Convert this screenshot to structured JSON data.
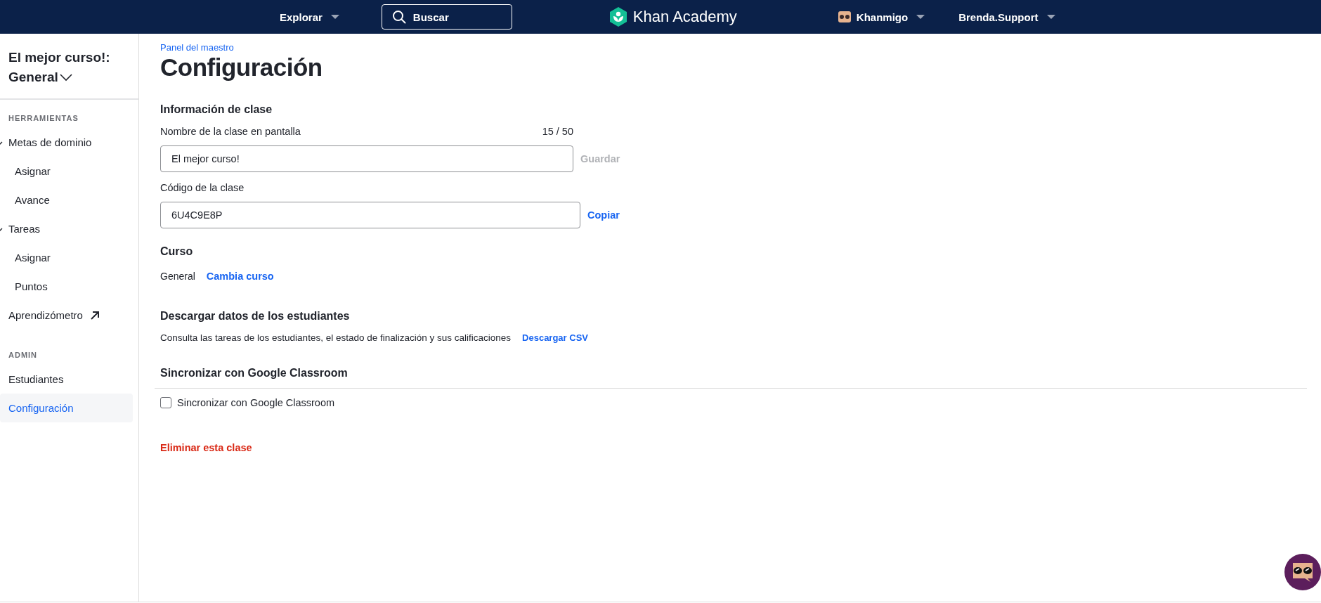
{
  "top_bar": {
    "explore": "Explorar",
    "search": {
      "placeholder": "Buscar"
    },
    "logo": "Khan Academy",
    "assistant": "Khanmigo",
    "user": "Brenda.Support"
  },
  "sidebar": {
    "class_title": "El mejor curso!:",
    "class_course": "General",
    "sections": [
      {
        "heading": "HERRAMIENTAS",
        "items": [
          {
            "label": "Metas de dominio",
            "kind": "group",
            "expanded": true,
            "selected": false,
            "children": [
              {
                "label": "Asignar",
                "selected": false
              },
              {
                "label": "Avance",
                "selected": false
              }
            ]
          },
          {
            "label": "Tareas",
            "kind": "group",
            "expanded": true,
            "selected": false,
            "children": [
              {
                "label": "Asignar",
                "selected": false
              },
              {
                "label": "Puntos",
                "selected": false
              }
            ]
          },
          {
            "label": "Aprendizómetro",
            "kind": "external",
            "selected": false
          }
        ]
      },
      {
        "heading": "ADMIN",
        "items": [
          {
            "label": "Estudiantes",
            "kind": "link",
            "selected": false
          },
          {
            "label": "Configuración",
            "kind": "link",
            "selected": true
          }
        ]
      }
    ]
  },
  "breadcrumb": "Panel del maestro",
  "title": "Configuración",
  "class_info": {
    "heading": "Información de clase",
    "name_label": "Nombre de la clase en pantalla",
    "name_count": "15 / 50",
    "name_value": "El mejor curso!",
    "save": "Guardar",
    "save_disabled": true,
    "code_label": "Código de la clase",
    "code_value": "6U4C9E8P",
    "copy": "Copiar"
  },
  "course": {
    "heading": "Curso",
    "value": "General",
    "change": "Cambia curso"
  },
  "download": {
    "heading": "Descargar datos de los estudiantes",
    "description": "Consulta las tareas de los estudiantes, el estado de finalización y sus calificaciones",
    "link": "Descargar CSV"
  },
  "google": {
    "heading": "Sincronizar con Google Classroom",
    "checkbox_label": "Sincronizar con Google Classroom",
    "checked": false
  },
  "delete": "Eliminar esta clase"
}
